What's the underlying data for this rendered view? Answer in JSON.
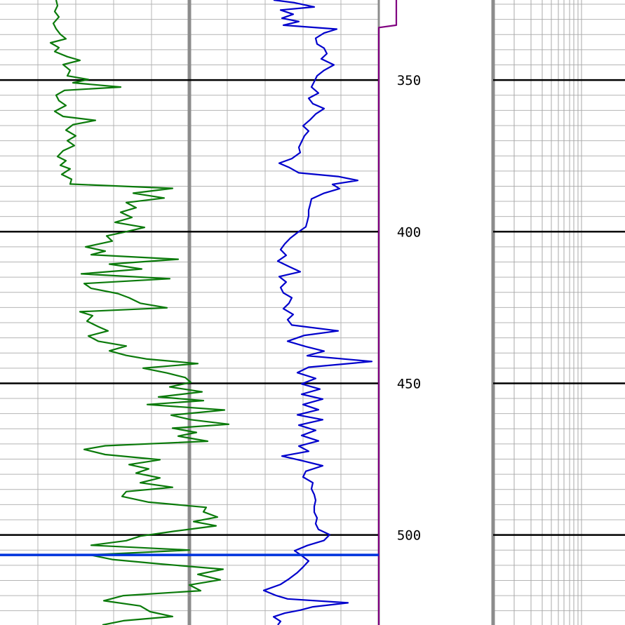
{
  "chart_data": {
    "type": "line",
    "title": "",
    "xlabel": "",
    "ylabel": "",
    "ylim": [
      323.6,
      529.7
    ],
    "y_inverted": true,
    "grid": true,
    "depth_ticks": [
      {
        "value": 350,
        "label": "350"
      },
      {
        "value": 400,
        "label": "400"
      },
      {
        "value": 450,
        "label": "450"
      },
      {
        "value": 500,
        "label": "500"
      }
    ],
    "marker_depth": 506.6,
    "series": [
      {
        "track": "left",
        "color": "#0a7a0a",
        "points": [
          [
            80,
            323.6
          ],
          [
            82,
            325.5
          ],
          [
            78,
            327.4
          ],
          [
            84,
            329.2
          ],
          [
            76,
            331.3
          ],
          [
            80,
            333.1
          ],
          [
            86,
            334.9
          ],
          [
            94,
            336.4
          ],
          [
            72,
            337.7
          ],
          [
            84,
            339.3
          ],
          [
            78,
            340.6
          ],
          [
            96,
            342.3
          ],
          [
            114,
            343.5
          ],
          [
            90,
            344.9
          ],
          [
            100,
            346.8
          ],
          [
            96,
            348.6
          ],
          [
            126,
            349.8
          ],
          [
            104,
            350.9
          ],
          [
            172,
            352.3
          ],
          [
            92,
            353.4
          ],
          [
            80,
            355
          ],
          [
            84,
            356.8
          ],
          [
            94,
            358.4
          ],
          [
            78,
            360.3
          ],
          [
            90,
            362
          ],
          [
            136,
            363.3
          ],
          [
            104,
            364.7
          ],
          [
            94,
            366.5
          ],
          [
            108,
            368.4
          ],
          [
            96,
            370
          ],
          [
            106,
            371.6
          ],
          [
            90,
            373.3
          ],
          [
            82,
            375.2
          ],
          [
            94,
            376.6
          ],
          [
            86,
            378.1
          ],
          [
            100,
            379.3
          ],
          [
            88,
            381.1
          ],
          [
            102,
            382.7
          ],
          [
            100,
            384.3
          ],
          [
            246,
            385.7
          ],
          [
            190,
            387.3
          ],
          [
            234,
            388.9
          ],
          [
            180,
            390.4
          ],
          [
            194,
            392.1
          ],
          [
            172,
            393.6
          ],
          [
            188,
            395.3
          ],
          [
            164,
            396.9
          ],
          [
            206,
            398.6
          ],
          [
            176,
            400.2
          ],
          [
            152,
            401.4
          ],
          [
            160,
            403.1
          ],
          [
            122,
            405
          ],
          [
            150,
            406.4
          ],
          [
            130,
            407.6
          ],
          [
            254,
            409.1
          ],
          [
            156,
            410.7
          ],
          [
            202,
            412.3
          ],
          [
            116,
            413.9
          ],
          [
            242,
            415.5
          ],
          [
            120,
            417.1
          ],
          [
            130,
            418.7
          ],
          [
            168,
            420.4
          ],
          [
            184,
            421.8
          ],
          [
            200,
            423.6
          ],
          [
            238,
            425.1
          ],
          [
            114,
            426.4
          ],
          [
            132,
            427.7
          ],
          [
            124,
            429.5
          ],
          [
            140,
            431.3
          ],
          [
            154,
            432.7
          ],
          [
            126,
            434.4
          ],
          [
            140,
            436.1
          ],
          [
            180,
            437.7
          ],
          [
            156,
            439.3
          ],
          [
            180,
            440.8
          ],
          [
            210,
            442
          ],
          [
            282,
            443.5
          ],
          [
            204,
            445
          ],
          [
            238,
            446.6
          ],
          [
            264,
            448.1
          ],
          [
            272,
            449.7
          ],
          [
            242,
            451.2
          ],
          [
            288,
            452.8
          ],
          [
            226,
            454.5
          ],
          [
            290,
            455.7
          ],
          [
            210,
            457
          ],
          [
            320,
            458.8
          ],
          [
            244,
            460.5
          ],
          [
            272,
            462
          ],
          [
            326,
            463.5
          ],
          [
            246,
            464.8
          ],
          [
            280,
            466.2
          ],
          [
            254,
            467.4
          ],
          [
            296,
            469.1
          ],
          [
            150,
            470.6
          ],
          [
            120,
            471.8
          ],
          [
            150,
            473.5
          ],
          [
            228,
            475.2
          ],
          [
            184,
            476.8
          ],
          [
            212,
            478.2
          ],
          [
            194,
            479.6
          ],
          [
            228,
            481.2
          ],
          [
            200,
            482.8
          ],
          [
            246,
            484.3
          ],
          [
            180,
            485.7
          ],
          [
            174,
            487.3
          ],
          [
            212,
            489.2
          ],
          [
            294,
            490.9
          ],
          [
            290,
            492.4
          ],
          [
            310,
            494.1
          ],
          [
            276,
            495.6
          ],
          [
            308,
            497
          ],
          [
            248,
            498.8
          ],
          [
            200,
            500.4
          ],
          [
            180,
            501.9
          ],
          [
            130,
            503.4
          ],
          [
            270,
            505
          ],
          [
            128,
            506.6
          ],
          [
            160,
            508.1
          ],
          [
            230,
            509.6
          ],
          [
            318,
            511.3
          ],
          [
            282,
            513
          ],
          [
            314,
            514.8
          ],
          [
            270,
            516.5
          ],
          [
            286,
            518.4
          ],
          [
            176,
            520
          ],
          [
            148,
            521.7
          ],
          [
            200,
            523.4
          ],
          [
            214,
            525.3
          ],
          [
            246,
            526.9
          ],
          [
            176,
            528.3
          ],
          [
            146,
            529.7
          ]
        ]
      },
      {
        "track": "middle",
        "color": "#0000cc",
        "points": [
          [
            390,
            323.6
          ],
          [
            420,
            324.5
          ],
          [
            448,
            325.9
          ],
          [
            400,
            326.9
          ],
          [
            418,
            328.3
          ],
          [
            402,
            329.6
          ],
          [
            426,
            330.7
          ],
          [
            404,
            331.9
          ],
          [
            480,
            333.2
          ],
          [
            462,
            334.5
          ],
          [
            450,
            336.2
          ],
          [
            452,
            338.1
          ],
          [
            462,
            339.5
          ],
          [
            466,
            341.3
          ],
          [
            458,
            343
          ],
          [
            476,
            345
          ],
          [
            462,
            346.8
          ],
          [
            452,
            348.6
          ],
          [
            448,
            350.5
          ],
          [
            444,
            352.3
          ],
          [
            454,
            354.3
          ],
          [
            440,
            356
          ],
          [
            446,
            357.8
          ],
          [
            462,
            359.4
          ],
          [
            450,
            361.2
          ],
          [
            442,
            363.1
          ],
          [
            432,
            365.1
          ],
          [
            440,
            366.8
          ],
          [
            434,
            368.4
          ],
          [
            430,
            370.3
          ],
          [
            426,
            372.2
          ],
          [
            428,
            373.9
          ],
          [
            416,
            375.9
          ],
          [
            398,
            377.4
          ],
          [
            412,
            378.8
          ],
          [
            426,
            380.6
          ],
          [
            482,
            381.8
          ],
          [
            510,
            383.1
          ],
          [
            474,
            384.4
          ],
          [
            484,
            385.8
          ],
          [
            462,
            387.3
          ],
          [
            444,
            389.2
          ],
          [
            442,
            391.2
          ],
          [
            440,
            392.9
          ],
          [
            440,
            394.8
          ],
          [
            438,
            396.7
          ],
          [
            436,
            398.4
          ],
          [
            424,
            400.3
          ],
          [
            414,
            402.1
          ],
          [
            406,
            404
          ],
          [
            400,
            405.9
          ],
          [
            408,
            407.8
          ],
          [
            396,
            409.7
          ],
          [
            412,
            411.5
          ],
          [
            428,
            413.2
          ],
          [
            398,
            414.8
          ],
          [
            408,
            416.6
          ],
          [
            400,
            418.4
          ],
          [
            404,
            420.2
          ],
          [
            416,
            421.8
          ],
          [
            412,
            423.6
          ],
          [
            404,
            425.4
          ],
          [
            418,
            427.3
          ],
          [
            410,
            429
          ],
          [
            416,
            430.8
          ],
          [
            482,
            432.7
          ],
          [
            434,
            434.2
          ],
          [
            410,
            436.1
          ],
          [
            436,
            437.9
          ],
          [
            462,
            439.4
          ],
          [
            438,
            440.9
          ],
          [
            530,
            442.8
          ],
          [
            440,
            444.7
          ],
          [
            424,
            446.5
          ],
          [
            450,
            448.4
          ],
          [
            430,
            450.2
          ],
          [
            456,
            451.9
          ],
          [
            430,
            453.6
          ],
          [
            460,
            455.2
          ],
          [
            432,
            457
          ],
          [
            454,
            458.7
          ],
          [
            424,
            460.4
          ],
          [
            460,
            462
          ],
          [
            426,
            463.8
          ],
          [
            450,
            465.5
          ],
          [
            430,
            467.2
          ],
          [
            454,
            469
          ],
          [
            426,
            470.7
          ],
          [
            440,
            472.4
          ],
          [
            402,
            474
          ],
          [
            432,
            475.6
          ],
          [
            460,
            477.2
          ],
          [
            436,
            479
          ],
          [
            432,
            480.9
          ],
          [
            446,
            482.8
          ],
          [
            444,
            484.8
          ],
          [
            448,
            486.7
          ],
          [
            450,
            488.6
          ],
          [
            448,
            490.6
          ],
          [
            448,
            492.5
          ],
          [
            452,
            494.4
          ],
          [
            450,
            496.3
          ],
          [
            454,
            498.2
          ],
          [
            470,
            499.9
          ],
          [
            462,
            501.8
          ],
          [
            438,
            503.5
          ],
          [
            420,
            505.2
          ],
          [
            430,
            506.8
          ],
          [
            440,
            508.6
          ],
          [
            432,
            510.6
          ],
          [
            424,
            512.4
          ],
          [
            412,
            514.5
          ],
          [
            400,
            516.3
          ],
          [
            376,
            518.3
          ],
          [
            394,
            520
          ],
          [
            410,
            521.1
          ],
          [
            496,
            522.4
          ],
          [
            446,
            523.7
          ],
          [
            428,
            524.8
          ],
          [
            406,
            525.8
          ],
          [
            390,
            527
          ],
          [
            400,
            528.5
          ],
          [
            396,
            529.7
          ]
        ]
      },
      {
        "track": "right-edge",
        "color": "#800080",
        "points": [
          [
            565,
            323.6
          ],
          [
            565,
            331.9
          ],
          [
            540,
            332.7
          ],
          [
            540,
            529.7
          ]
        ]
      }
    ]
  }
}
